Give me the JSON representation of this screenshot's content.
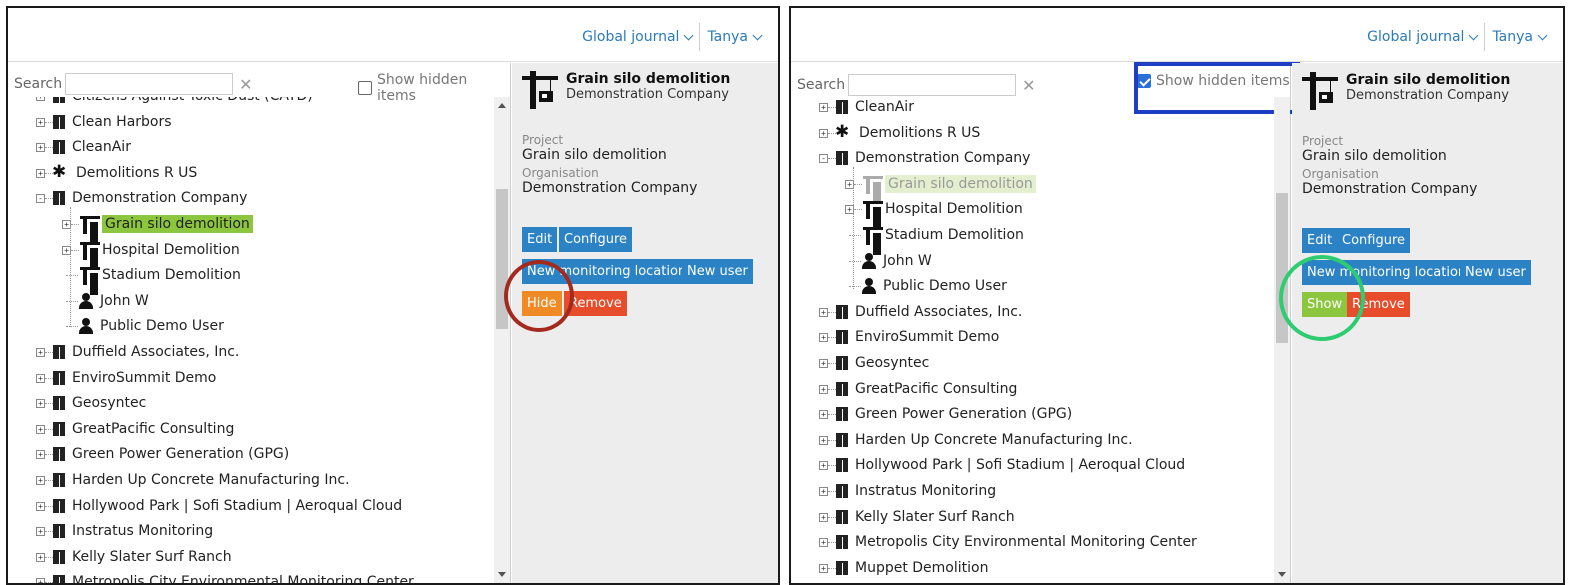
{
  "nav": {
    "journal": "Global journal",
    "user": "Tanya"
  },
  "search": {
    "label": "Search",
    "value": "",
    "placeholder": "",
    "clear": "✕",
    "show_hidden_label": "Show hidden items"
  },
  "panel1": {
    "show_hidden_checked": false,
    "tree": [
      {
        "label": "Citizens Against Toxic Dust (CATD)",
        "icon": "building-icon"
      },
      {
        "label": "Clean Harbors",
        "icon": "building-icon"
      },
      {
        "label": "CleanAir",
        "icon": "building-icon"
      },
      {
        "label": "Demolitions R US",
        "icon": "network-icon"
      },
      {
        "label": "Demonstration Company",
        "icon": "building-icon"
      },
      {
        "label": "Grain silo demolition",
        "icon": "crane-icon"
      },
      {
        "label": "Hospital Demolition",
        "icon": "crane-icon"
      },
      {
        "label": "Stadium Demolition",
        "icon": "crane-icon"
      },
      {
        "label": "John W",
        "icon": "person-icon"
      },
      {
        "label": "Public Demo User",
        "icon": "person-icon"
      },
      {
        "label": "Duffield Associates, Inc.",
        "icon": "building-icon"
      },
      {
        "label": "EnviroSummit Demo",
        "icon": "building-icon"
      },
      {
        "label": "Geosyntec",
        "icon": "building-icon"
      },
      {
        "label": "GreatPacific Consulting",
        "icon": "building-icon"
      },
      {
        "label": "Green Power Generation (GPG)",
        "icon": "building-icon"
      },
      {
        "label": "Harden Up Concrete Manufacturing Inc.",
        "icon": "building-icon"
      },
      {
        "label": "Hollywood Park | Sofi Stadium | Aeroqual Cloud",
        "icon": "building-icon"
      },
      {
        "label": "Instratus Monitoring",
        "icon": "building-icon"
      },
      {
        "label": "Kelly Slater Surf Ranch",
        "icon": "building-icon"
      },
      {
        "label": "Metropolis City Environmental Monitoring Center",
        "icon": "building-icon"
      }
    ],
    "detail": {
      "title": "Grain silo demolition",
      "company": "Demonstration Company",
      "project_label": "Project",
      "project_value": "Grain silo demolition",
      "org_label": "Organisation",
      "org_value": "Demonstration Company",
      "buttons": {
        "edit": "Edit",
        "configure": "Configure",
        "new_location": "New monitoring location",
        "new_user": "New user",
        "hide": "Hide",
        "remove": "Remove"
      }
    }
  },
  "panel2": {
    "show_hidden_checked": true,
    "tree": [
      {
        "label": "CleanAir",
        "icon": "building-icon"
      },
      {
        "label": "Demolitions R US",
        "icon": "network-icon"
      },
      {
        "label": "Demonstration Company",
        "icon": "building-icon"
      },
      {
        "label": "Grain silo demolition",
        "icon": "crane-icon"
      },
      {
        "label": "Hospital Demolition",
        "icon": "crane-icon"
      },
      {
        "label": "Stadium Demolition",
        "icon": "crane-icon"
      },
      {
        "label": "John W",
        "icon": "person-icon"
      },
      {
        "label": "Public Demo User",
        "icon": "person-icon"
      },
      {
        "label": "Duffield Associates, Inc.",
        "icon": "building-icon"
      },
      {
        "label": "EnviroSummit Demo",
        "icon": "building-icon"
      },
      {
        "label": "Geosyntec",
        "icon": "building-icon"
      },
      {
        "label": "GreatPacific Consulting",
        "icon": "building-icon"
      },
      {
        "label": "Green Power Generation (GPG)",
        "icon": "building-icon"
      },
      {
        "label": "Harden Up Concrete Manufacturing Inc.",
        "icon": "building-icon"
      },
      {
        "label": "Hollywood Park | Sofi Stadium | Aeroqual Cloud",
        "icon": "building-icon"
      },
      {
        "label": "Instratus Monitoring",
        "icon": "building-icon"
      },
      {
        "label": "Kelly Slater Surf Ranch",
        "icon": "building-icon"
      },
      {
        "label": "Metropolis City Environmental Monitoring Center",
        "icon": "building-icon"
      },
      {
        "label": "Muppet Demolition",
        "icon": "building-icon"
      }
    ],
    "detail": {
      "title": "Grain silo demolition",
      "company": "Demonstration Company",
      "project_label": "Project",
      "project_value": "Grain silo demolition",
      "org_label": "Organisation",
      "org_value": "Demonstration Company",
      "buttons": {
        "edit": "Edit",
        "configure": "Configure",
        "new_location": "New monitoring location",
        "new_user": "New user",
        "show": "Show",
        "remove": "Remove"
      }
    }
  },
  "colors": {
    "accent": "#2b83c6",
    "selected": "#8cc63f",
    "hide": "#f08a24",
    "remove": "#e74c2b",
    "highlight_red": "#a52a1e",
    "highlight_green": "#2ecc71",
    "highlight_blue": "#1d3fc4"
  }
}
